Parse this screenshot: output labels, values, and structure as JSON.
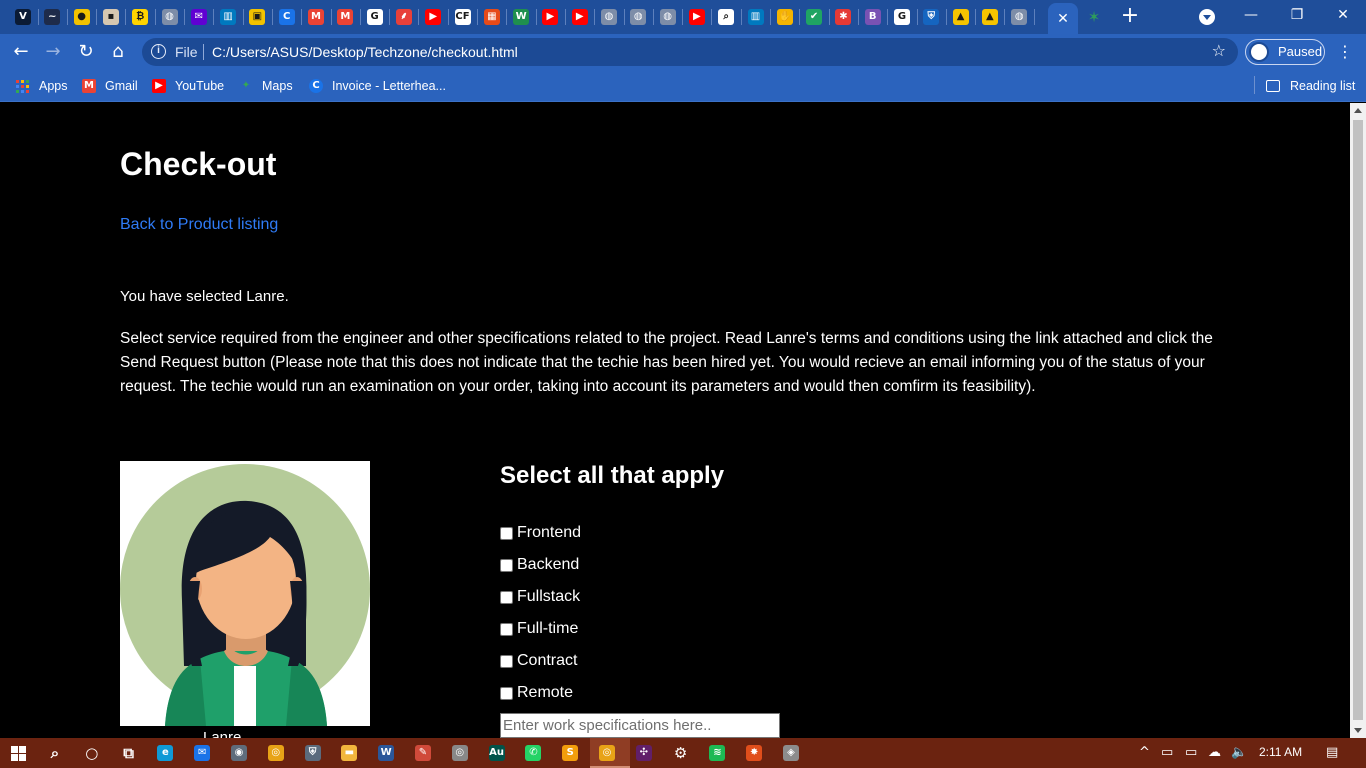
{
  "browser": {
    "tabs": [
      {
        "icon": "letterboxd-icon",
        "color": "#0b1b35",
        "glyph": "V"
      },
      {
        "icon": "bootstrap-icon",
        "color": "#1e2b4a",
        "glyph": "~"
      },
      {
        "icon": "circle-yellow-icon",
        "color": "#f2c200",
        "glyph": "●"
      },
      {
        "icon": "profile-photo-icon",
        "color": "#d6c7b0",
        "glyph": "▪"
      },
      {
        "icon": "coin-icon",
        "color": "#ffd400",
        "glyph": "₿"
      },
      {
        "icon": "globe-icon",
        "color": "#7d8da8",
        "glyph": "◍"
      },
      {
        "icon": "yahoo-mail-icon",
        "color": "#6001d2",
        "glyph": "✉"
      },
      {
        "icon": "trello-icon",
        "color": "#0079bf",
        "glyph": "▥"
      },
      {
        "icon": "folder-icon",
        "color": "#f2c200",
        "glyph": "▣"
      },
      {
        "icon": "canva-icon",
        "color": "#1a73e8",
        "glyph": "C"
      },
      {
        "icon": "gmail-icon",
        "color": "#ea4335",
        "glyph": "M"
      },
      {
        "icon": "gmail-icon",
        "color": "#ea4335",
        "glyph": "M"
      },
      {
        "icon": "google-icon",
        "color": "#ffffff",
        "glyph": "G"
      },
      {
        "icon": "feather-icon",
        "color": "#e8403a",
        "glyph": "⸙"
      },
      {
        "icon": "youtube-icon",
        "color": "#ff0000",
        "glyph": "▶"
      },
      {
        "icon": "codeforces-icon",
        "color": "#ffffff",
        "glyph": "CF"
      },
      {
        "icon": "palette-icon",
        "color": "#e64a19",
        "glyph": "▦"
      },
      {
        "icon": "wattpad-icon",
        "color": "#1f8f4e",
        "glyph": "W"
      },
      {
        "icon": "youtube-icon",
        "color": "#ff0000",
        "glyph": "▶"
      },
      {
        "icon": "youtube-icon",
        "color": "#ff0000",
        "glyph": "▶"
      },
      {
        "icon": "globe-icon",
        "color": "#7d8da8",
        "glyph": "◍"
      },
      {
        "icon": "globe-icon",
        "color": "#7d8da8",
        "glyph": "◍"
      },
      {
        "icon": "globe-icon",
        "color": "#7d8da8",
        "glyph": "◍"
      },
      {
        "icon": "youtube-icon",
        "color": "#ff0000",
        "glyph": "▶"
      },
      {
        "icon": "search-page-icon",
        "color": "#ffffff",
        "glyph": "⌕"
      },
      {
        "icon": "trello-icon",
        "color": "#0079bf",
        "glyph": "▥"
      },
      {
        "icon": "hand-icon",
        "color": "#f5b400",
        "glyph": "✋"
      },
      {
        "icon": "check-icon",
        "color": "#1fa463",
        "glyph": "✔"
      },
      {
        "icon": "asterisk-icon",
        "color": "#e53935",
        "glyph": "✱"
      },
      {
        "icon": "bootstrap-b-icon",
        "color": "#7952b3",
        "glyph": "B"
      },
      {
        "icon": "google-icon",
        "color": "#ffffff",
        "glyph": "G"
      },
      {
        "icon": "shield-icon",
        "color": "#1565c0",
        "glyph": "⛨"
      },
      {
        "icon": "image-icon",
        "color": "#f5c400",
        "glyph": "▲"
      },
      {
        "icon": "image-icon",
        "color": "#f5c400",
        "glyph": "▲"
      },
      {
        "icon": "globe-icon",
        "color": "#7d8da8",
        "glyph": "◍"
      }
    ],
    "active_tab": {
      "icon": "close-icon",
      "glyph": "✕"
    },
    "after_active": {
      "icon": "sparkle-icon",
      "color": "#2e9c5c",
      "glyph": "✶"
    },
    "new_tab_glyph": "+",
    "window": {
      "minimize": "—",
      "restore": "❐",
      "close": "✕"
    },
    "address": {
      "scheme_label": "File",
      "url": "C:/Users/ASUS/Desktop/Techzone/checkout.html"
    },
    "profile_label": "Paused",
    "bookmarks": [
      {
        "label": "Apps",
        "icon": "apps-grid-icon",
        "color": "#ffffff",
        "glyph": ""
      },
      {
        "label": "Gmail",
        "icon": "gmail-icon",
        "color": "#ea4335",
        "glyph": "M"
      },
      {
        "label": "YouTube",
        "icon": "youtube-icon",
        "color": "#ff0000",
        "glyph": "▶"
      },
      {
        "label": "Maps",
        "icon": "maps-icon",
        "color": "#34a853",
        "glyph": "✦"
      },
      {
        "label": "Invoice - Letterhea...",
        "icon": "canva-icon",
        "color": "#1a73e8",
        "glyph": "C"
      }
    ],
    "reading_list": "Reading list"
  },
  "page": {
    "title": "Check-out",
    "back_link": "Back to Product listing",
    "selected_text": "You have selected Lanre.",
    "instructions": "Select service required from the engineer and other specifications related to the project. Read Lanre's terms and conditions using the link attached and click the Send Request button (Please note that this does not indicate that the techie has been hired yet. You would recieve an email informing you of the status of your request. The techie would run an examination on your order, taking into account its parameters and would then comfirm its feasibility).",
    "engineer_name": "Lanre",
    "options_heading": "Select all that apply",
    "options": [
      {
        "label": "Frontend",
        "checked": false
      },
      {
        "label": "Backend",
        "checked": false
      },
      {
        "label": "Fullstack",
        "checked": false
      },
      {
        "label": "Full-time",
        "checked": false
      },
      {
        "label": "Contract",
        "checked": false
      },
      {
        "label": "Remote",
        "checked": false
      }
    ],
    "specs_placeholder": "Enter work specifications here.."
  },
  "taskbar": {
    "apps": [
      {
        "icon": "search-icon",
        "color": "transparent",
        "glyph": "⌕"
      },
      {
        "icon": "cortana-icon",
        "color": "transparent",
        "glyph": "○"
      },
      {
        "icon": "task-view-icon",
        "color": "transparent",
        "glyph": "⧉"
      },
      {
        "icon": "edge-icon",
        "color": "#0f9ad6",
        "glyph": "e"
      },
      {
        "icon": "mail-icon",
        "color": "#1a73e8",
        "glyph": "✉"
      },
      {
        "icon": "camera-icon",
        "color": "#5f6c7b",
        "glyph": "◉"
      },
      {
        "icon": "chrome-icon",
        "color": "#e8a317",
        "glyph": "◎"
      },
      {
        "icon": "security-icon",
        "color": "#5b6b7d",
        "glyph": "⛨"
      },
      {
        "icon": "file-explorer-icon",
        "color": "#f2b63d",
        "glyph": "▬"
      },
      {
        "icon": "word-icon",
        "color": "#2b579a",
        "glyph": "W"
      },
      {
        "icon": "paint-icon",
        "color": "#d04a3a",
        "glyph": "✎"
      },
      {
        "icon": "media-icon",
        "color": "#888888",
        "glyph": "◎"
      },
      {
        "icon": "audition-icon",
        "color": "#00534a",
        "glyph": "Au"
      },
      {
        "icon": "whatsapp-icon",
        "color": "#25d366",
        "glyph": "✆"
      },
      {
        "icon": "sublime-icon",
        "color": "#f29d0c",
        "glyph": "S"
      },
      {
        "icon": "chrome-active-icon",
        "color": "#e8a317",
        "glyph": "◎"
      },
      {
        "icon": "slack-icon",
        "color": "#611f69",
        "glyph": "✣"
      },
      {
        "icon": "settings-icon",
        "color": "transparent",
        "glyph": "⚙"
      },
      {
        "icon": "spotify-icon",
        "color": "#1db954",
        "glyph": "≋"
      },
      {
        "icon": "aim-icon",
        "color": "#e04e1b",
        "glyph": "✸"
      },
      {
        "icon": "paint3d-icon",
        "color": "#8c8c8c",
        "glyph": "◈"
      }
    ],
    "tray": {
      "chevron": "^",
      "network": "▭",
      "battery": "▭",
      "cloud": "☁",
      "volume": "🔈",
      "notifications": "▤"
    },
    "clock": "2:11 AM"
  }
}
